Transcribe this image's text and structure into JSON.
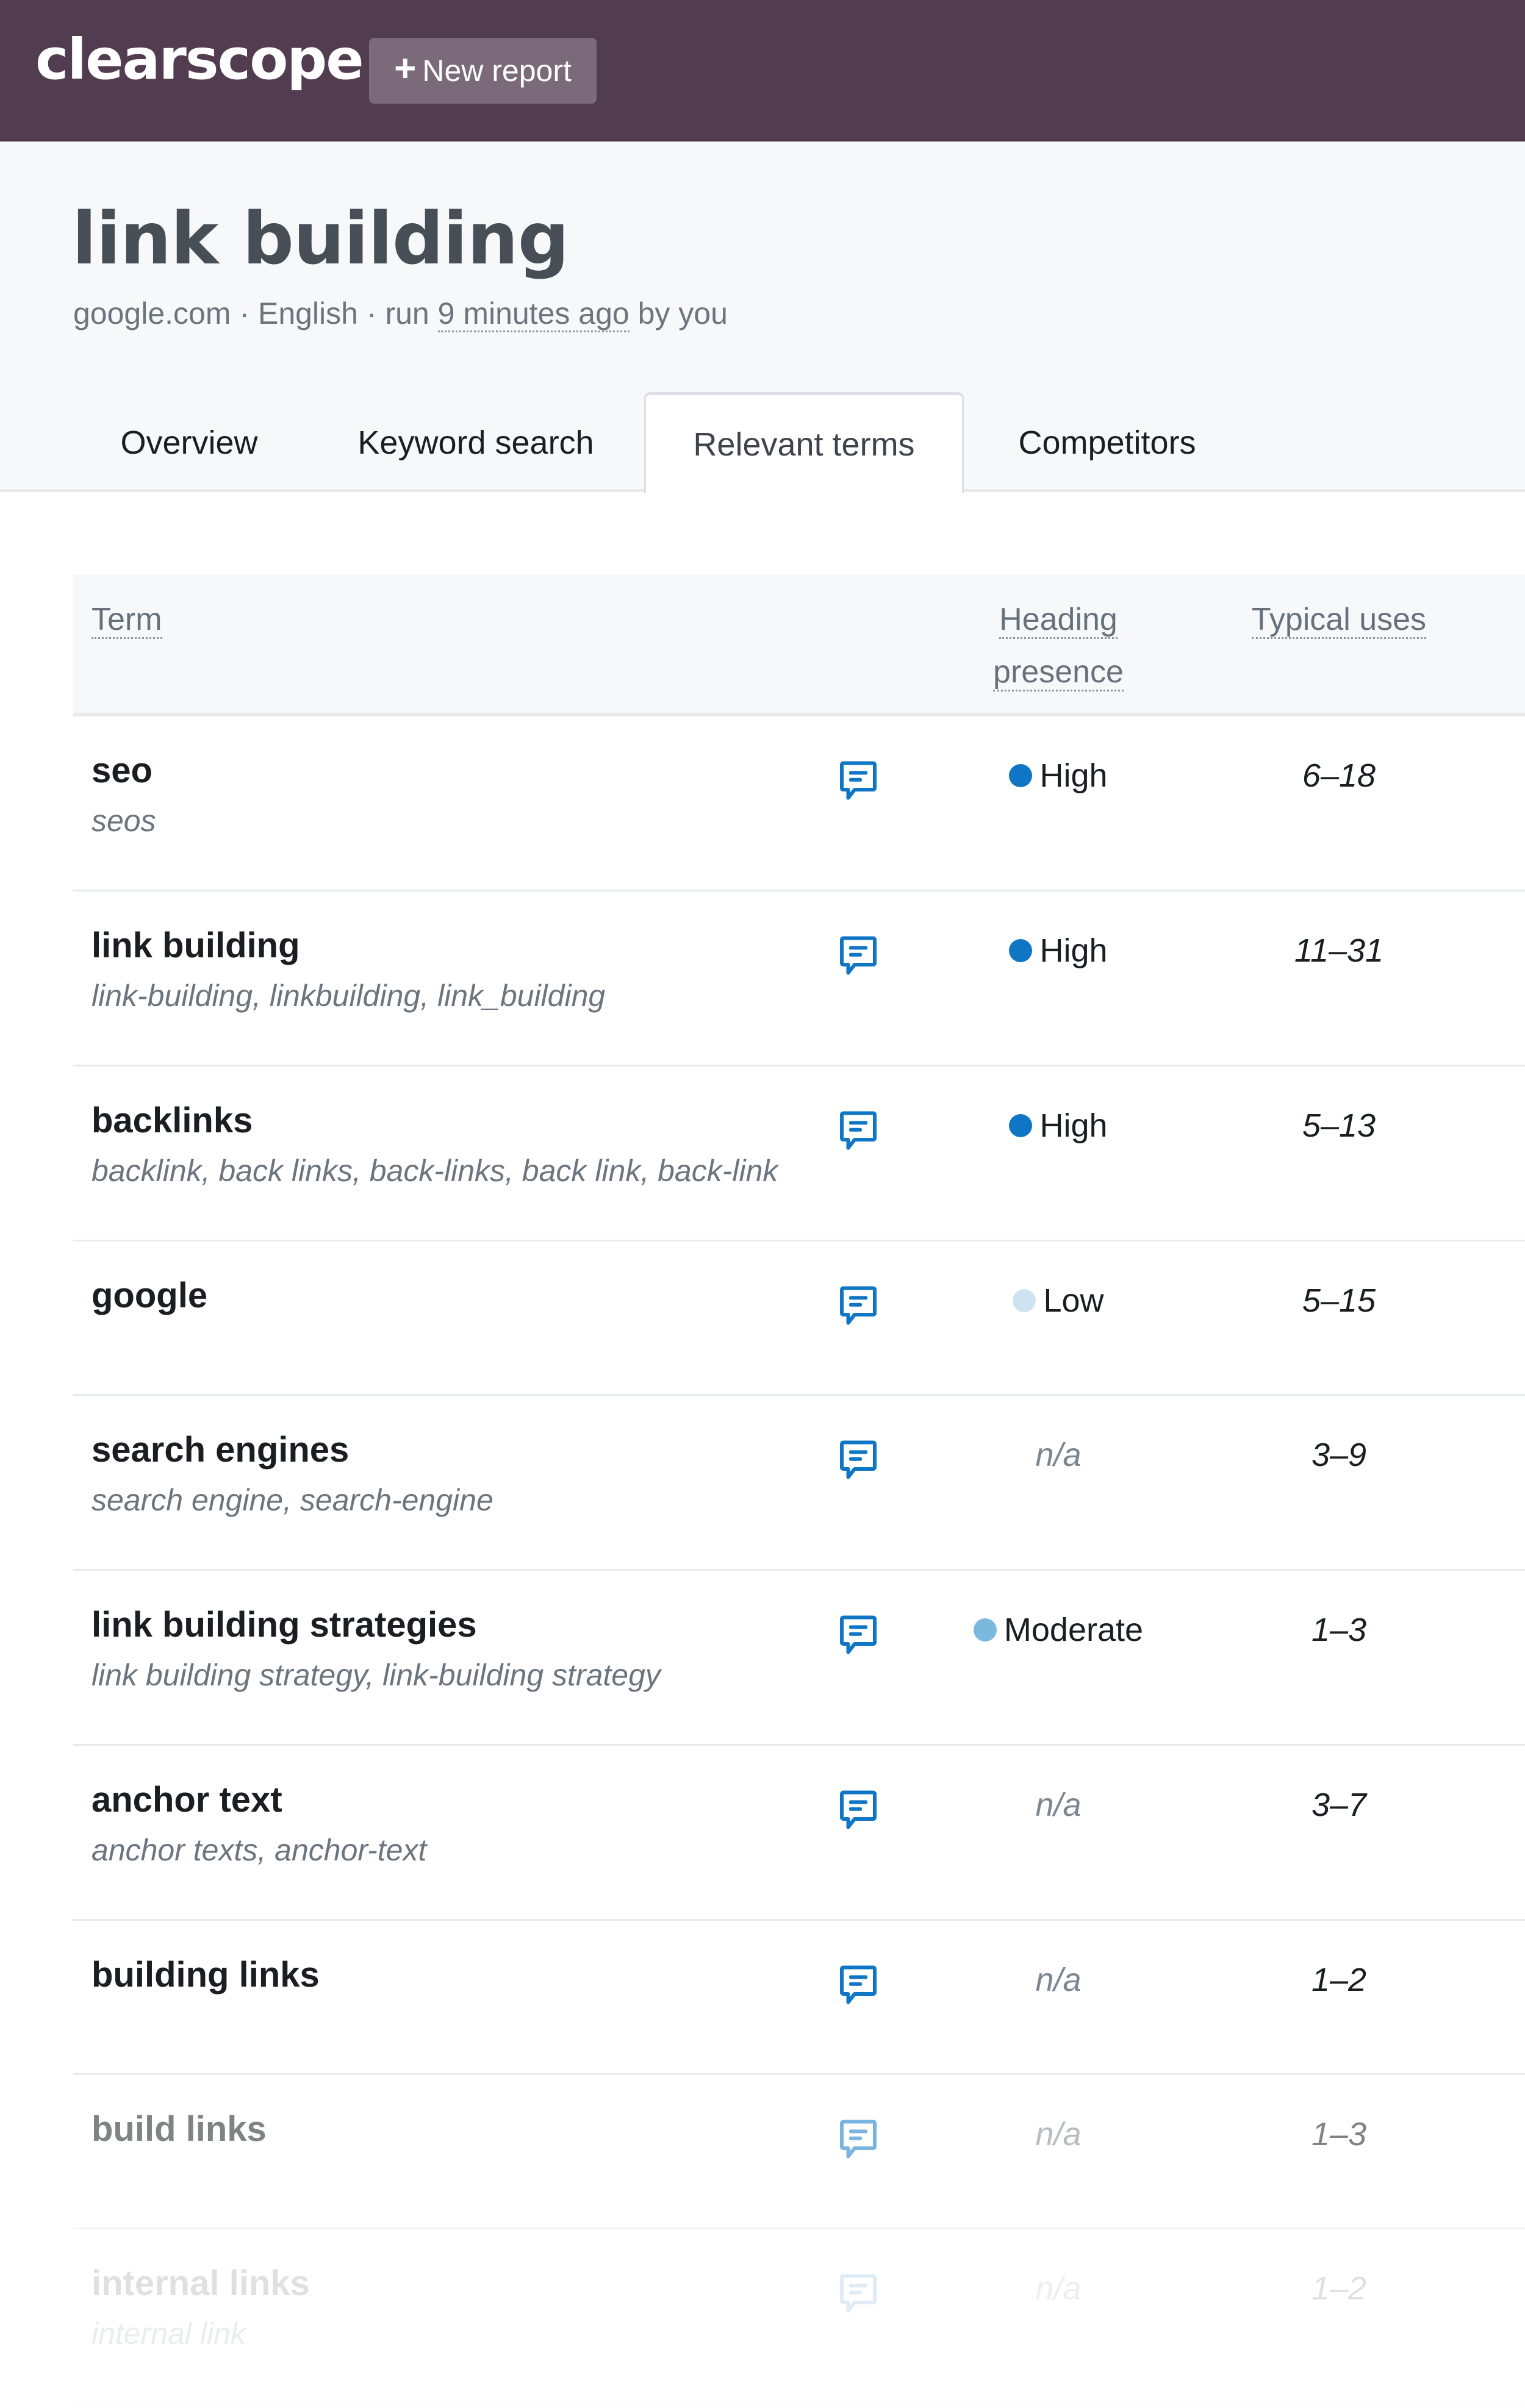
{
  "header": {
    "logo": "clearscope",
    "new_report_icon": "plus-icon",
    "new_report_label": "New report",
    "background_color": "#523d50"
  },
  "report": {
    "title": "link building",
    "domain": "google.com",
    "language": "English",
    "run_prefix": "run",
    "run_time": "9 minutes ago",
    "run_suffix": "by you",
    "separator": "·"
  },
  "tabs": [
    {
      "label": "Overview",
      "active": false
    },
    {
      "label": "Keyword search",
      "active": false
    },
    {
      "label": "Relevant terms",
      "active": true
    },
    {
      "label": "Competitors",
      "active": false
    }
  ],
  "table": {
    "columns": {
      "term": "Term",
      "heading_presence_line1": "Heading",
      "heading_presence_line2": "presence",
      "typical_uses": "Typical uses"
    },
    "presence_colors": {
      "High": "#0f76c5",
      "Moderate": "#7ab8de",
      "Low": "#cde3f1"
    },
    "comment_icon_color": "#0f76c5",
    "rows": [
      {
        "term": "seo",
        "variants": "seos",
        "presence": "High",
        "uses": "6–18"
      },
      {
        "term": "link building",
        "variants": "link-building, linkbuilding, link_building",
        "presence": "High",
        "uses": "11–31"
      },
      {
        "term": "backlinks",
        "variants": "backlink, back links, back-links, back link, back-link",
        "presence": "High",
        "uses": "5–13"
      },
      {
        "term": "google",
        "variants": "",
        "presence": "Low",
        "uses": "5–15"
      },
      {
        "term": "search engines",
        "variants": "search engine, search-engine",
        "presence": "n/a",
        "uses": "3–9"
      },
      {
        "term": "link building strategies",
        "variants": "link building strategy, link-building strategy",
        "presence": "Moderate",
        "uses": "1–3"
      },
      {
        "term": "anchor text",
        "variants": "anchor texts, anchor-text",
        "presence": "n/a",
        "uses": "3–7"
      },
      {
        "term": "building links",
        "variants": "",
        "presence": "n/a",
        "uses": "1–2"
      },
      {
        "term": "build links",
        "variants": "",
        "presence": "n/a",
        "uses": "1–3"
      },
      {
        "term": "internal links",
        "variants": "internal link",
        "presence": "n/a",
        "uses": "1–2"
      }
    ]
  }
}
